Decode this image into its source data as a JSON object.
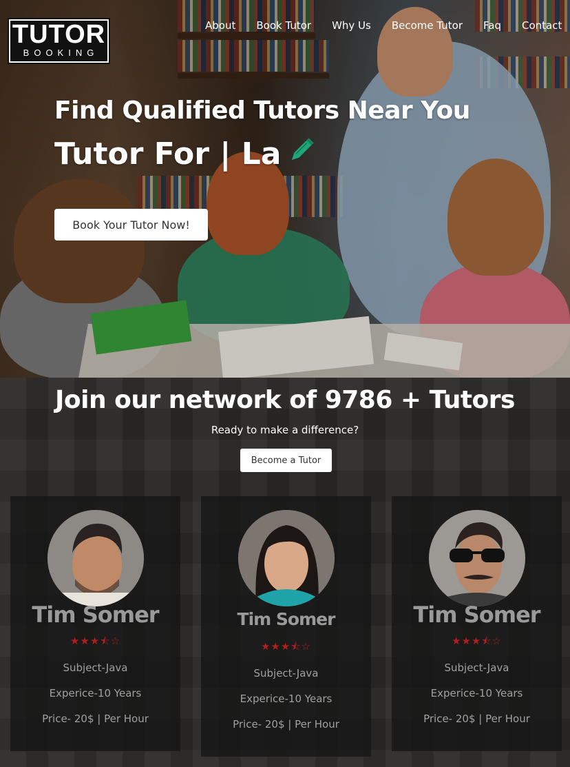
{
  "logo": {
    "top": "TUTOR",
    "bottom": "BOOKING"
  },
  "nav": [
    "About",
    "Book Tutor",
    "Why Us",
    "Become Tutor",
    "Faq",
    "Contact"
  ],
  "hero": {
    "title": "Find Qualified Tutors Near You",
    "typed_prefix": "Tutor For | La",
    "cta_label": "Book Your Tutor Now!",
    "pencil_icon": "pencil-icon",
    "pencil_color": "#1fa67a"
  },
  "network": {
    "title": "Join our network of 9786 + Tutors",
    "subtitle": "Ready to make a difference?",
    "button_label": "Become a Tutor"
  },
  "tutors": [
    {
      "name": "Tim Somer",
      "rating": 3.5,
      "subject": "Subject-Java",
      "experience": "Experice-10 Years",
      "price": "Price- 20$ | Per Hour"
    },
    {
      "name": "Tim Somer",
      "rating": 3.5,
      "subject": "Subject-Java",
      "experience": "Experice-10 Years",
      "price": "Price- 20$ | Per Hour"
    },
    {
      "name": "Tim Somer",
      "rating": 3.5,
      "subject": "Subject-Java",
      "experience": "Experice-10 Years",
      "price": "Price- 20$ | Per Hour"
    }
  ],
  "colors": {
    "star": "#b01e1e",
    "accent": "#1fa67a"
  }
}
